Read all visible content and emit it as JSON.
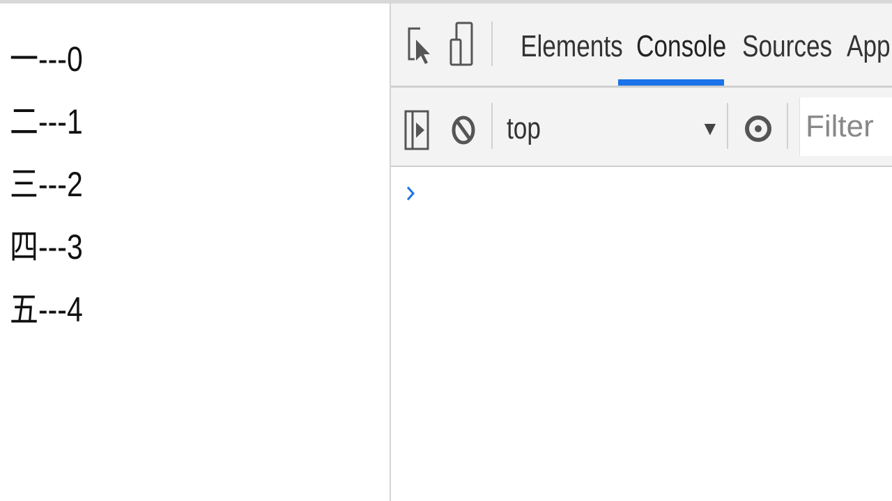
{
  "page": {
    "lines": [
      {
        "cjk": "一",
        "suffix": "---0"
      },
      {
        "cjk": "二",
        "suffix": "---1"
      },
      {
        "cjk": "三",
        "suffix": "---2"
      },
      {
        "cjk": "四",
        "suffix": "---3"
      },
      {
        "cjk": "五",
        "suffix": "---4"
      }
    ]
  },
  "devtools": {
    "tabs": [
      {
        "label": "Elements",
        "active": false
      },
      {
        "label": "Console",
        "active": true
      },
      {
        "label": "Sources",
        "active": false
      },
      {
        "label": "Appli",
        "active": false
      }
    ],
    "accent_color": "#1a73e8",
    "console_toolbar": {
      "context": "top",
      "filter_placeholder": "Filter"
    },
    "prompt_symbol": "chevron-right-icon"
  }
}
